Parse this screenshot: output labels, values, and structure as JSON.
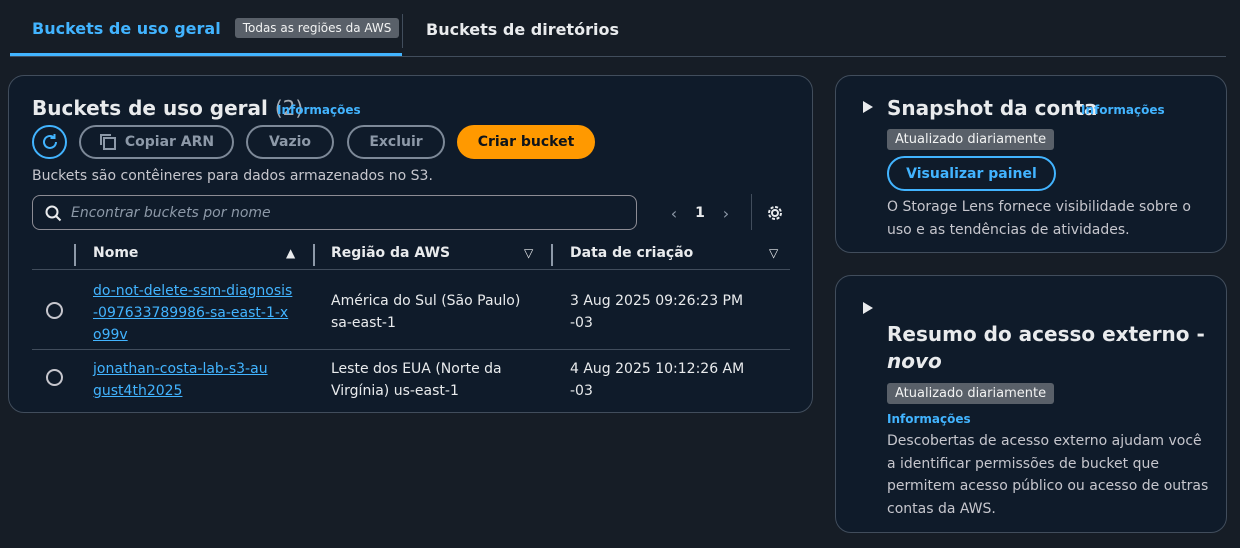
{
  "tabs": {
    "general": "Buckets de uso geral",
    "general_badge": "Todas as regiões da AWS",
    "directory": "Buckets de diretórios"
  },
  "main": {
    "title": "Buckets de uso geral",
    "count": "(2)",
    "info": "Informações",
    "buttons": {
      "copy_arn": "Copiar ARN",
      "empty": "Vazio",
      "delete": "Excluir",
      "create": "Criar bucket"
    },
    "description": "Buckets são contêineres para dados armazenados no S3.",
    "search_placeholder": "Encontrar buckets por nome",
    "page": "1",
    "columns": [
      "Nome",
      "Região da AWS",
      "Data de criação"
    ],
    "rows": [
      {
        "name": "do-not-delete-ssm-diagnosis-097633789986-sa-east-1-xo99v",
        "region_line1": "América do Sul (São Paulo)",
        "region_line2": "sa-east-1",
        "date_line1": "3 Aug 2025 09:26:23 PM",
        "date_line2": "-03"
      },
      {
        "name": "jonathan-costa-lab-s3-august4th2025",
        "region_line1": "Leste dos EUA (Norte da",
        "region_line2": "Virgínia) us-east-1",
        "date_line1": "4 Aug 2025 10:12:26 AM",
        "date_line2": "-03"
      }
    ]
  },
  "snapshot": {
    "title": "Snapshot da conta",
    "info": "Informações",
    "badge": "Atualizado diariamente",
    "button": "Visualizar painel",
    "text_line1": "O Storage Lens fornece visibilidade sobre o",
    "text_line2": "uso e as tendências de atividades."
  },
  "external": {
    "title_line1": "Resumo do acesso externo -",
    "title_line2": "novo",
    "badge": "Atualizado diariamente",
    "info": "Informações",
    "text_line1": "Descobertas de acesso externo ajudam você",
    "text_line2": "a identificar permissões de bucket que",
    "text_line3": "permitem acesso público ou acesso de outras",
    "text_line4": "contas da AWS."
  },
  "icons": [
    "refresh-icon",
    "copy-icon",
    "search-icon",
    "chevron-left-icon",
    "chevron-right-icon",
    "gear-icon",
    "sort-asc-icon",
    "sort-desc-icon",
    "caret-right-icon"
  ],
  "colors": {
    "accent": "#42b4ff",
    "primary_button": "#ff9900",
    "background": "#161d26",
    "panel": "#0f1b2a"
  }
}
